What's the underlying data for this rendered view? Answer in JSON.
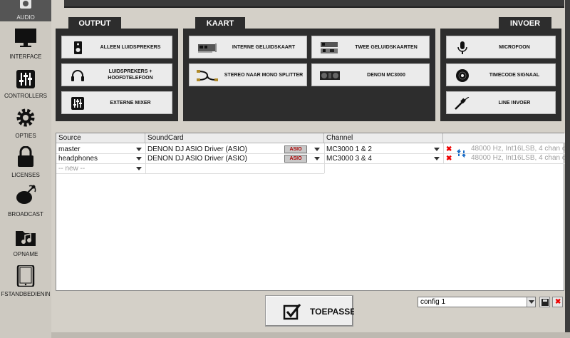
{
  "sidebar": {
    "items": [
      {
        "label": "AUDIO",
        "icon": "speaker-icon",
        "active": true
      },
      {
        "label": "INTERFACE",
        "icon": "monitor-icon"
      },
      {
        "label": "CONTROLLERS",
        "icon": "sliders-icon"
      },
      {
        "label": "OPTIES",
        "icon": "gear-icon"
      },
      {
        "label": "LICENSES",
        "icon": "lock-icon"
      },
      {
        "label": "BROADCAST",
        "icon": "broadcast-icon"
      },
      {
        "label": "OPNAME",
        "icon": "music-folder-icon"
      },
      {
        "label": "FSTANDBEDIENIN",
        "icon": "tablet-icon"
      }
    ]
  },
  "panels": {
    "output": {
      "title": "OUTPUT",
      "buttons": [
        {
          "label": "ALLEEN LUIDSPREKERS",
          "icon": "speaker-box-icon"
        },
        {
          "label": "LUIDSPREKERS + HOOFDTELEFOON",
          "icon": "headphones-icon"
        },
        {
          "label": "EXTERNE MIXER",
          "icon": "mixer-icon"
        }
      ]
    },
    "kaart": {
      "title": "KAART",
      "buttons": [
        {
          "label": "INTERNE GELUIDSKAART",
          "icon": "soundcard-icon"
        },
        {
          "label": "TWEE GELUIDSKAARTEN",
          "icon": "dual-soundcard-icon"
        },
        {
          "label": "STEREO NAAR MONO SPLITTER",
          "icon": "splitter-cable-icon"
        },
        {
          "label": "DENON MC3000",
          "icon": "controller-icon"
        }
      ]
    },
    "invoer": {
      "title": "INVOER",
      "buttons": [
        {
          "label": "MICROFOON",
          "icon": "microphone-icon"
        },
        {
          "label": "TIMECODE SIGNAAL",
          "icon": "vinyl-icon"
        },
        {
          "label": "LINE INVOER",
          "icon": "jack-cable-icon"
        }
      ]
    }
  },
  "table": {
    "headers": [
      "Source",
      "SoundCard",
      "Channel"
    ],
    "rows": [
      {
        "source": "master",
        "soundcard": "DENON DJ ASIO Driver (ASIO)",
        "asio": "ASIO",
        "channel": "MC3000 1 & 2",
        "info": "48000 Hz, Int16LSB, 4 chan o"
      },
      {
        "source": "headphones",
        "soundcard": "DENON DJ ASIO Driver (ASIO)",
        "asio": "ASIO",
        "channel": "MC3000 3 & 4",
        "info": "48000 Hz, Int16LSB, 4 chan o"
      }
    ],
    "new_row": "-- new --"
  },
  "footer": {
    "apply_label": "TOEPASSEN",
    "config_value": "config 1"
  },
  "colors": {
    "panel_bg": "#2d2d2d",
    "delete_red": "#e00000",
    "arrow_blue": "#1e6fc8"
  }
}
